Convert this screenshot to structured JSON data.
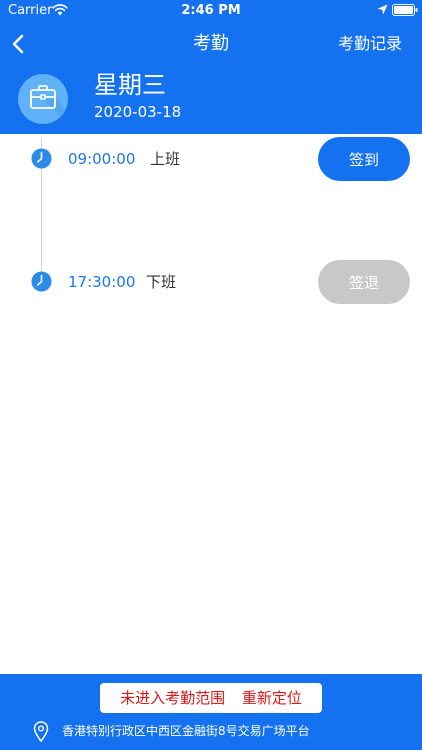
{
  "status_bar": {
    "carrier": "Carrier",
    "time": "2:46 PM"
  },
  "nav": {
    "title": "考勤",
    "records_label": "考勤记录"
  },
  "header": {
    "weekday": "星期三",
    "date": "2020-03-18",
    "icon": "briefcase-icon"
  },
  "entries": [
    {
      "time": "09:00:00",
      "label": "上班",
      "button": "签到",
      "enabled": true
    },
    {
      "time": "17:30:00",
      "label": "下班",
      "button": "签退",
      "enabled": false
    }
  ],
  "footer": {
    "notice": "未进入考勤范围",
    "relocate": "重新定位",
    "address": "香港特别行政区中西区金融街8号交易广场平台"
  },
  "colors": {
    "primary": "#1472f0",
    "avatar_bg": "#5fb2f8",
    "time_text": "#1a78e8",
    "disabled_button": "#c8c8c8",
    "warning_text": "#e01717"
  }
}
